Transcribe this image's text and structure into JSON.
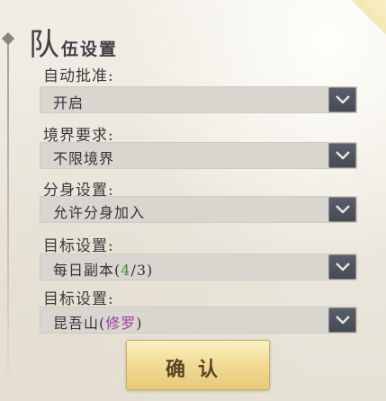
{
  "title": {
    "big": "队",
    "rest": "伍设置"
  },
  "settings": [
    {
      "label": "自动批准:",
      "value_parts": [
        {
          "text": "开启",
          "color": ""
        }
      ]
    },
    {
      "label": "境界要求:",
      "value_parts": [
        {
          "text": "不限境界",
          "color": ""
        }
      ]
    },
    {
      "label": "分身设置:",
      "value_parts": [
        {
          "text": "允许分身加入",
          "color": ""
        }
      ]
    },
    {
      "label": "目标设置:",
      "value_parts": [
        {
          "text": "每日副本(",
          "color": ""
        },
        {
          "text": "4",
          "color": "#3e8c3a"
        },
        {
          "text": "/3)",
          "color": ""
        }
      ]
    },
    {
      "label": "目标设置:",
      "value_parts": [
        {
          "text": "昆吾山(",
          "color": ""
        },
        {
          "text": "修罗",
          "color": "#9b3f9f"
        },
        {
          "text": ")",
          "color": ""
        }
      ]
    }
  ],
  "confirm_label": "确认",
  "colors": {
    "dropdown_button": "#4d515c",
    "confirm_gold": "#f2dc97",
    "highlight_green": "#3e8c3a",
    "highlight_purple": "#9b3f9f"
  },
  "icons": {
    "dropdown": "chevron-down-icon"
  }
}
